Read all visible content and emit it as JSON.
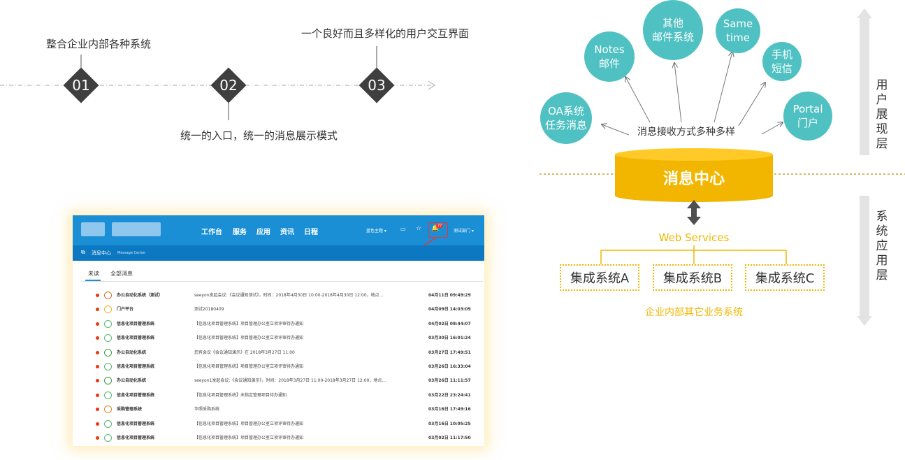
{
  "timeline": {
    "steps": [
      {
        "num": "01",
        "text": "整合企业内部各种系统"
      },
      {
        "num": "02",
        "text": "统一的入口，统一的消息展示模式"
      },
      {
        "num": "03",
        "text": "一个良好而且多样化的用户交互界面"
      }
    ]
  },
  "screenshot": {
    "nav": [
      "工作台",
      "服务",
      "应用",
      "资讯",
      "日程"
    ],
    "theme_label": "蓝色主题 ▾",
    "user_label": "测试部门 ▾",
    "badge": "77",
    "subheader_title": "消息中心",
    "subheader_en": "Message Center",
    "tabs": [
      "未读",
      "全部消息"
    ],
    "rows": [
      {
        "source": "办公自动化系统（测试）",
        "message": "seeyon发起会议:《会议通知测试》，时间：2018年4月30日 10:00-2018年4月30日 12:00，地点...",
        "time": "04月11日 09:49:29"
      },
      {
        "source": "门户平台",
        "message": "测试20180409",
        "time": "04月09日 14:03:09"
      },
      {
        "source": "信息化项目管理系统",
        "message": "【信息化项目管理系统】项目管理办公室立项评审待办通知",
        "time": "04月02日 08:44:07"
      },
      {
        "source": "信息化项目管理系统",
        "message": "【信息化项目管理系统】项目管理办公室立项评审待办通知",
        "time": "03月30日 16:01:24"
      },
      {
        "source": "办公自动化系统",
        "message": "您有会议《会议通知演示》在 2018年3月27日 11:00",
        "time": "03月27日 17:49:51"
      },
      {
        "source": "信息化项目管理系统",
        "message": "【信息化项目管理系统】项目管理办公室立项评审待办通知",
        "time": "03月26日 16:33:04"
      },
      {
        "source": "办公自动化系统",
        "message": "seeyon1发起会议:《会议通知演示》，时间：2018年3月27日 11:00-2018年3月27日 12:00，地点...",
        "time": "03月26日 11:11:57"
      },
      {
        "source": "信息化项目管理系统",
        "message": "【信息化项目管理系统】未指定管理项目待办通知",
        "time": "03月22日 23:24:41"
      },
      {
        "source": "采购管理系统",
        "message": "华照采购系统",
        "time": "03月16日 17:49:16"
      },
      {
        "source": "信息化项目管理系统",
        "message": "【信息化项目管理系统】项目管理办公室立项评审待办通知",
        "time": "03月16日 10:05:25"
      },
      {
        "source": "信息化项目管理系统",
        "message": "【信息化项目管理系统】项目管理办公室立项评审待办通知",
        "time": "03月02日 11:17:50"
      }
    ]
  },
  "diagram": {
    "bubbles": [
      {
        "key": "oa",
        "line1": "OA系统",
        "line2": "任务消息"
      },
      {
        "key": "notes",
        "line1": "Notes",
        "line2": "邮件"
      },
      {
        "key": "other",
        "line1": "其他",
        "line2": "邮件系统"
      },
      {
        "key": "same",
        "line1": "Same",
        "line2": "time"
      },
      {
        "key": "sms",
        "line1": "手机",
        "line2": "短信"
      },
      {
        "key": "portal",
        "line1": "Portal",
        "line2": "门户"
      }
    ],
    "receive_text": "消息接收方式多种多样",
    "center_label": "消息中心",
    "ws_label": "Web Services",
    "systems": [
      "集成系统A",
      "集成系统B",
      "集成系统C"
    ],
    "bottom_label": "企业内部其它业务系统",
    "layer_top": "用户展现层",
    "layer_bottom": "系统应用层",
    "colors": {
      "teal": "#4fc1c2",
      "gold": "#f2b600",
      "dark": "#3f3f3f"
    }
  }
}
